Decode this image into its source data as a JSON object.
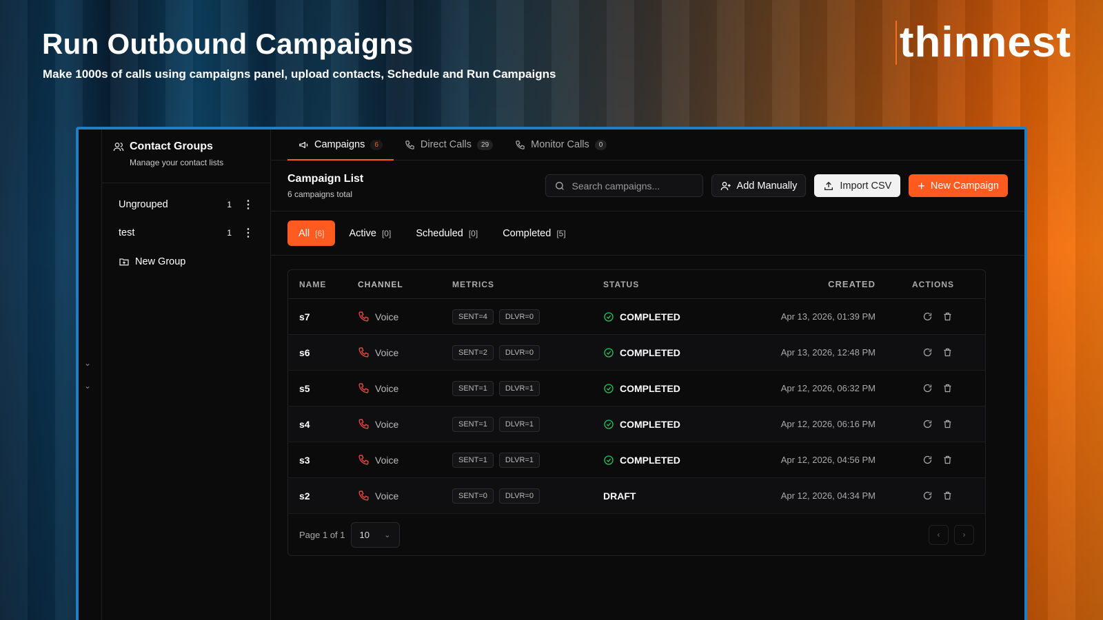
{
  "hero": {
    "title": "Run Outbound Campaigns",
    "subtitle": "Make 1000s of calls using campaigns panel, upload contacts, Schedule and Run Campaigns",
    "brand": "thinnest"
  },
  "sidebar": {
    "title": "Contact Groups",
    "subtitle": "Manage your contact lists",
    "groups": [
      {
        "name": "Ungrouped",
        "count": "1"
      },
      {
        "name": "test",
        "count": "1"
      }
    ],
    "new_group": "New Group"
  },
  "tabs": [
    {
      "label": "Campaigns",
      "badge": "6",
      "icon": "megaphone-icon"
    },
    {
      "label": "Direct Calls",
      "badge": "29",
      "icon": "phone-icon"
    },
    {
      "label": "Monitor Calls",
      "badge": "0",
      "icon": "phone-icon"
    }
  ],
  "toolbar": {
    "title": "Campaign List",
    "subtitle": "6 campaigns total",
    "search_placeholder": "Search campaigns...",
    "add_manually": "Add Manually",
    "import_csv": "Import CSV",
    "new_campaign": "New Campaign"
  },
  "filters": [
    {
      "label": "All",
      "count": "[6]"
    },
    {
      "label": "Active",
      "count": "[0]"
    },
    {
      "label": "Scheduled",
      "count": "[0]"
    },
    {
      "label": "Completed",
      "count": "[5]"
    }
  ],
  "table": {
    "headers": [
      "NAME",
      "CHANNEL",
      "METRICS",
      "STATUS",
      "CREATED",
      "ACTIONS"
    ],
    "rows": [
      {
        "name": "s7",
        "channel": "Voice",
        "sent": "SENT=4",
        "dlvr": "DLVR=0",
        "status": "COMPLETED",
        "created": "Apr 13, 2026, 01:39 PM"
      },
      {
        "name": "s6",
        "channel": "Voice",
        "sent": "SENT=2",
        "dlvr": "DLVR=0",
        "status": "COMPLETED",
        "created": "Apr 13, 2026, 12:48 PM"
      },
      {
        "name": "s5",
        "channel": "Voice",
        "sent": "SENT=1",
        "dlvr": "DLVR=1",
        "status": "COMPLETED",
        "created": "Apr 12, 2026, 06:32 PM"
      },
      {
        "name": "s4",
        "channel": "Voice",
        "sent": "SENT=1",
        "dlvr": "DLVR=1",
        "status": "COMPLETED",
        "created": "Apr 12, 2026, 06:16 PM"
      },
      {
        "name": "s3",
        "channel": "Voice",
        "sent": "SENT=1",
        "dlvr": "DLVR=1",
        "status": "COMPLETED",
        "created": "Apr 12, 2026, 04:56 PM"
      },
      {
        "name": "s2",
        "channel": "Voice",
        "sent": "SENT=0",
        "dlvr": "DLVR=0",
        "status": "DRAFT",
        "created": "Apr 12, 2026, 04:34 PM"
      }
    ]
  },
  "pager": {
    "label": "Page 1 of 1",
    "page_size": "10"
  },
  "colors": {
    "accent": "#ff5a1f",
    "frame_border": "#1e7fc4",
    "completed": "#22c55e",
    "voice_icon": "#ef4444"
  }
}
